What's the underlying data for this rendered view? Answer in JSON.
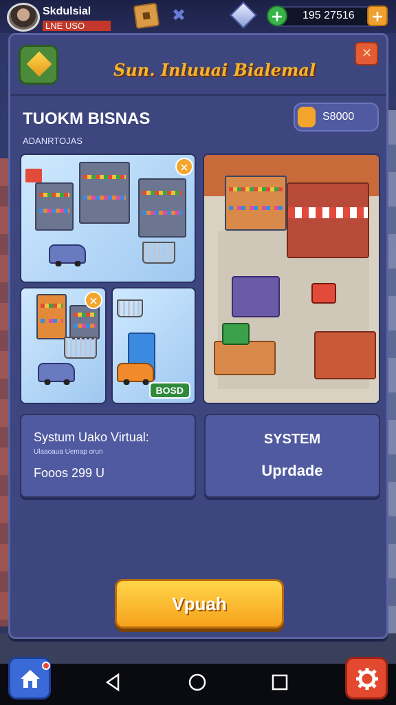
{
  "hud": {
    "player_name": "Skdulsial",
    "player_sub": "LNE USO",
    "cash": "195 27516"
  },
  "panel": {
    "title": "Sun. Inluuai Bialemal",
    "section_title": "TUOKM BISNAS",
    "section_sub": "ADANRTOJAS",
    "price": "S8000"
  },
  "tiles": {
    "cart_badge": "BOSD"
  },
  "cards": {
    "left": {
      "title": "Systum Uako Virtual:",
      "desc": "Ulaaoaua Uemap orun",
      "value": "Fooos 299 U"
    },
    "right": {
      "title": "SYSTEM",
      "sub": "Uprdade"
    }
  },
  "main_button": "Vpuah",
  "colors": {
    "panel_bg": "#3d467e",
    "accent_orange": "#f6a21c",
    "title_gold": "#f5b52b",
    "close_red": "#e45c35"
  }
}
